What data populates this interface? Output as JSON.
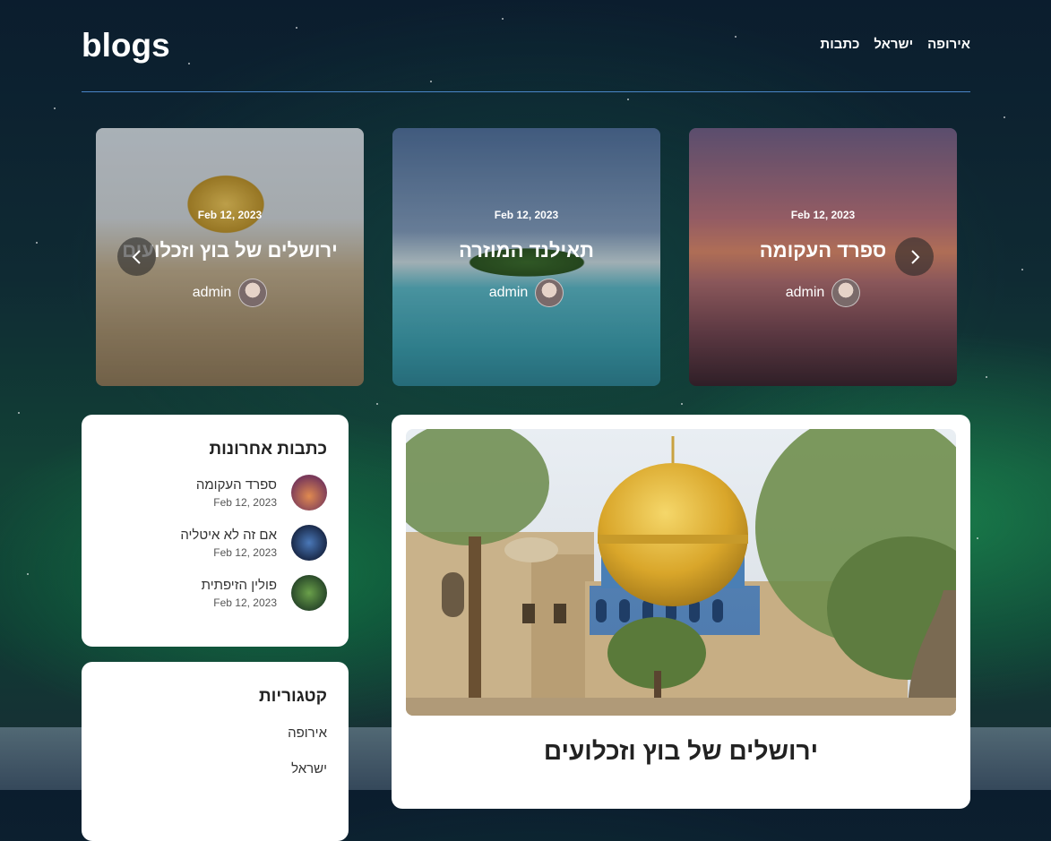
{
  "site": {
    "logo": "blogs"
  },
  "nav": {
    "items": [
      "אירופה",
      "ישראל",
      "כתבות"
    ]
  },
  "slider": {
    "slides": [
      {
        "date": "Feb 12, 2023",
        "title": "ירושלים של בוץ וזכלועים",
        "author": "admin"
      },
      {
        "date": "Feb 12, 2023",
        "title": "תאילנד המוזרה",
        "author": "admin"
      },
      {
        "date": "Feb 12, 2023",
        "title": "ספרד העקומה",
        "author": "admin"
      }
    ]
  },
  "recent": {
    "heading": "כתבות אחרונות",
    "items": [
      {
        "title": "ספרד העקומה",
        "date": "Feb 12, 2023"
      },
      {
        "title": "אם זה לא איטליה",
        "date": "Feb 12, 2023"
      },
      {
        "title": "פולין הזיפתית",
        "date": "Feb 12, 2023"
      }
    ]
  },
  "categories": {
    "heading": "קטגוריות",
    "items": [
      "אירופה",
      "ישראל"
    ]
  },
  "post": {
    "title": "ירושלים של בוץ וזכלועים"
  },
  "colors": {
    "divider": "#4a86c8",
    "card_bg": "#ffffff"
  }
}
